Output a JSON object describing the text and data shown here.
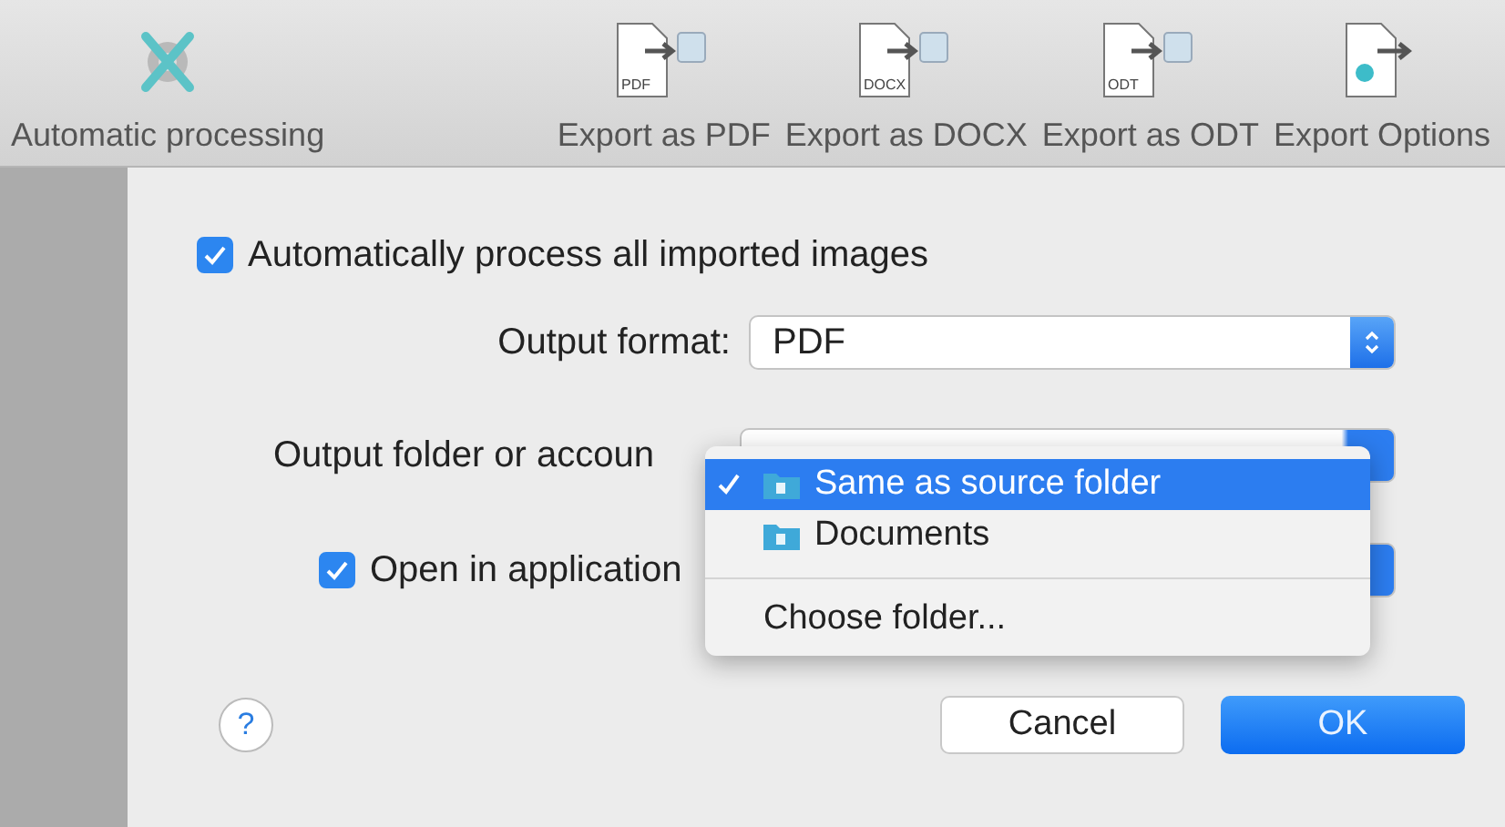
{
  "toolbar": {
    "items": [
      {
        "kind": "auto",
        "label": "Automatic processing"
      },
      {
        "kind": "export",
        "label": "Export as PDF",
        "doc_label": "PDF"
      },
      {
        "kind": "export",
        "label": "Export as DOCX",
        "doc_label": "DOCX"
      },
      {
        "kind": "export",
        "label": "Export as ODT",
        "doc_label": "ODT"
      },
      {
        "kind": "options",
        "label": "Export Options"
      }
    ]
  },
  "dialog": {
    "auto_process": {
      "label": "Automatically process all imported images",
      "checked": true
    },
    "output_format": {
      "label": "Output format:",
      "value": "PDF"
    },
    "output_folder": {
      "label": "Output folder or accoun"
    },
    "open_in_app": {
      "label": "Open in application",
      "checked": true
    },
    "menu": [
      {
        "label": "Same as source folder",
        "selected": true,
        "kind": "folder"
      },
      {
        "label": "Documents",
        "selected": false,
        "kind": "folder"
      },
      {
        "kind": "separator"
      },
      {
        "label": "Choose folder...",
        "selected": false,
        "kind": "action"
      }
    ],
    "buttons": [
      {
        "label": "Cancel",
        "kind": "secondary"
      },
      {
        "label": "OK",
        "kind": "primary"
      }
    ],
    "help": "?"
  }
}
